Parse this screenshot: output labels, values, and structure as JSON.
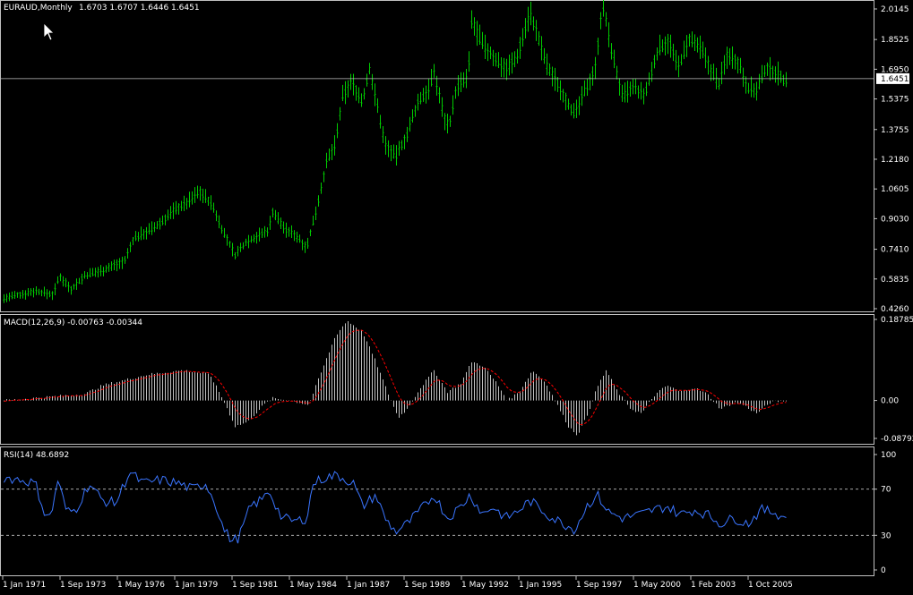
{
  "chart_data": {
    "type": "multi-panel",
    "colors": {
      "background": "#000000",
      "price_bars": "#00cc00",
      "macd_hist": "#c0c0c0",
      "macd_signal": "#ff0000",
      "rsi_line": "#3a75ff",
      "frame": "#c0c0c0",
      "level_line": "#c0c0c0"
    },
    "x_labels": [
      "1 Jan 1971",
      "1 Sep 1973",
      "1 May 1976",
      "1 Jan 1979",
      "1 Sep 1981",
      "1 May 1984",
      "1 Jan 1987",
      "1 Sep 1989",
      "1 May 1992",
      "1 Jan 1995",
      "1 Sep 1997",
      "1 May 2000",
      "1 Feb 2003",
      "1 Oct 2005"
    ],
    "price": {
      "symbol": "EURAUD,Monthly",
      "ohlc_text": "1.6703 1.6707 1.6446 1.6451",
      "last": "1.6451",
      "last_value": 1.6451,
      "ylim": [
        0.426,
        2.0145
      ],
      "ticks": [
        "2.0145",
        "1.8525",
        "1.6950",
        "1.5375",
        "1.3755",
        "1.2180",
        "1.0605",
        "0.9030",
        "0.7410",
        "0.5835",
        "0.4260"
      ],
      "anchors": [
        [
          0,
          0.48
        ],
        [
          35,
          0.52
        ],
        [
          55,
          0.5
        ],
        [
          62,
          0.6
        ],
        [
          75,
          0.53
        ],
        [
          90,
          0.6
        ],
        [
          110,
          0.63
        ],
        [
          135,
          0.68
        ],
        [
          145,
          0.8
        ],
        [
          170,
          0.86
        ],
        [
          190,
          0.95
        ],
        [
          205,
          0.99
        ],
        [
          218,
          1.05
        ],
        [
          232,
          0.98
        ],
        [
          245,
          0.83
        ],
        [
          258,
          0.71
        ],
        [
          270,
          0.78
        ],
        [
          295,
          0.84
        ],
        [
          300,
          0.94
        ],
        [
          315,
          0.84
        ],
        [
          325,
          0.82
        ],
        [
          338,
          0.75
        ],
        [
          350,
          0.98
        ],
        [
          360,
          1.2
        ],
        [
          370,
          1.3
        ],
        [
          378,
          1.55
        ],
        [
          388,
          1.63
        ],
        [
          400,
          1.52
        ],
        [
          408,
          1.7
        ],
        [
          418,
          1.47
        ],
        [
          425,
          1.3
        ],
        [
          437,
          1.23
        ],
        [
          450,
          1.35
        ],
        [
          462,
          1.52
        ],
        [
          475,
          1.6
        ],
        [
          480,
          1.68
        ],
        [
          492,
          1.43
        ],
        [
          497,
          1.4
        ],
        [
          505,
          1.6
        ],
        [
          518,
          1.65
        ],
        [
          522,
          1.95
        ],
        [
          535,
          1.82
        ],
        [
          548,
          1.75
        ],
        [
          560,
          1.7
        ],
        [
          572,
          1.75
        ],
        [
          587,
          2.0
        ],
        [
          597,
          1.85
        ],
        [
          607,
          1.7
        ],
        [
          618,
          1.62
        ],
        [
          637,
          1.45
        ],
        [
          650,
          1.6
        ],
        [
          660,
          1.7
        ],
        [
          668,
          2.05
        ],
        [
          678,
          1.8
        ],
        [
          690,
          1.55
        ],
        [
          703,
          1.6
        ],
        [
          715,
          1.55
        ],
        [
          730,
          1.8
        ],
        [
          742,
          1.85
        ],
        [
          752,
          1.7
        ],
        [
          765,
          1.85
        ],
        [
          778,
          1.8
        ],
        [
          788,
          1.7
        ],
        [
          798,
          1.62
        ],
        [
          808,
          1.78
        ],
        [
          820,
          1.73
        ],
        [
          830,
          1.6
        ],
        [
          840,
          1.58
        ],
        [
          850,
          1.7
        ],
        [
          862,
          1.68
        ],
        [
          872,
          1.63
        ],
        [
          880,
          1.64
        ]
      ]
    },
    "macd": {
      "label": "MACD(12,26,9) -0.00763 -0.00344",
      "ylim": [
        -0.08792,
        0.18785
      ],
      "ticks": [
        "0.18785",
        "0.00",
        "-0.08792"
      ],
      "anchors": [
        [
          0,
          0.0
        ],
        [
          30,
          0.005
        ],
        [
          60,
          0.01
        ],
        [
          90,
          0.015
        ],
        [
          110,
          0.035
        ],
        [
          140,
          0.05
        ],
        [
          160,
          0.06
        ],
        [
          200,
          0.07
        ],
        [
          230,
          0.06
        ],
        [
          245,
          0.0
        ],
        [
          258,
          -0.06
        ],
        [
          272,
          -0.05
        ],
        [
          290,
          -0.01
        ],
        [
          300,
          0.005
        ],
        [
          320,
          0.0
        ],
        [
          340,
          -0.01
        ],
        [
          355,
          0.07
        ],
        [
          370,
          0.15
        ],
        [
          383,
          0.185
        ],
        [
          400,
          0.16
        ],
        [
          415,
          0.09
        ],
        [
          428,
          0.02
        ],
        [
          440,
          -0.04
        ],
        [
          450,
          -0.02
        ],
        [
          465,
          0.03
        ],
        [
          480,
          0.07
        ],
        [
          495,
          0.02
        ],
        [
          510,
          0.04
        ],
        [
          522,
          0.09
        ],
        [
          535,
          0.08
        ],
        [
          550,
          0.04
        ],
        [
          562,
          0.0
        ],
        [
          575,
          0.02
        ],
        [
          590,
          0.07
        ],
        [
          605,
          0.04
        ],
        [
          615,
          0.0
        ],
        [
          630,
          -0.06
        ],
        [
          640,
          -0.08
        ],
        [
          650,
          -0.04
        ],
        [
          662,
          0.03
        ],
        [
          672,
          0.07
        ],
        [
          685,
          0.02
        ],
        [
          700,
          -0.02
        ],
        [
          712,
          -0.03
        ],
        [
          725,
          0.01
        ],
        [
          740,
          0.035
        ],
        [
          755,
          0.02
        ],
        [
          770,
          0.03
        ],
        [
          785,
          0.015
        ],
        [
          800,
          -0.02
        ],
        [
          815,
          -0.005
        ],
        [
          825,
          -0.01
        ],
        [
          840,
          -0.03
        ],
        [
          855,
          -0.005
        ],
        [
          870,
          0.0
        ],
        [
          880,
          -0.008
        ]
      ]
    },
    "rsi": {
      "label": "RSI(14) 48.6892",
      "ylim": [
        0,
        100
      ],
      "levels": [
        70,
        30
      ],
      "ticks": [
        "100",
        "70",
        "30",
        "0"
      ],
      "anchors": [
        [
          0,
          80
        ],
        [
          20,
          78
        ],
        [
          35,
          75
        ],
        [
          45,
          50
        ],
        [
          52,
          45
        ],
        [
          60,
          78
        ],
        [
          70,
          50
        ],
        [
          80,
          52
        ],
        [
          95,
          75
        ],
        [
          110,
          60
        ],
        [
          125,
          58
        ],
        [
          140,
          85
        ],
        [
          155,
          75
        ],
        [
          175,
          78
        ],
        [
          195,
          75
        ],
        [
          210,
          70
        ],
        [
          225,
          75
        ],
        [
          235,
          60
        ],
        [
          245,
          35
        ],
        [
          255,
          25
        ],
        [
          262,
          28
        ],
        [
          275,
          55
        ],
        [
          290,
          62
        ],
        [
          295,
          70
        ],
        [
          310,
          45
        ],
        [
          325,
          42
        ],
        [
          338,
          45
        ],
        [
          345,
          75
        ],
        [
          358,
          80
        ],
        [
          372,
          82
        ],
        [
          390,
          75
        ],
        [
          400,
          55
        ],
        [
          415,
          65
        ],
        [
          425,
          45
        ],
        [
          437,
          33
        ],
        [
          450,
          40
        ],
        [
          465,
          52
        ],
        [
          480,
          65
        ],
        [
          495,
          45
        ],
        [
          510,
          55
        ],
        [
          520,
          65
        ],
        [
          535,
          48
        ],
        [
          545,
          55
        ],
        [
          560,
          45
        ],
        [
          572,
          50
        ],
        [
          587,
          60
        ],
        [
          600,
          52
        ],
        [
          612,
          45
        ],
        [
          625,
          40
        ],
        [
          637,
          35
        ],
        [
          650,
          55
        ],
        [
          662,
          65
        ],
        [
          675,
          50
        ],
        [
          690,
          45
        ],
        [
          710,
          48
        ],
        [
          725,
          52
        ],
        [
          740,
          55
        ],
        [
          755,
          48
        ],
        [
          770,
          52
        ],
        [
          785,
          48
        ],
        [
          800,
          40
        ],
        [
          815,
          45
        ],
        [
          830,
          40
        ],
        [
          845,
          52
        ],
        [
          860,
          50
        ],
        [
          872,
          45
        ],
        [
          880,
          50
        ]
      ]
    }
  }
}
